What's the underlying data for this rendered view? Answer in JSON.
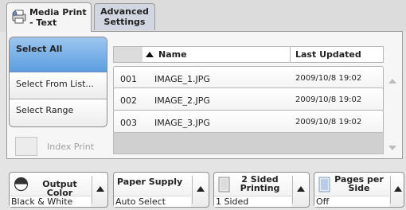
{
  "tabs": [
    {
      "label_line1": "Media Print",
      "label_line2": "- Text",
      "active": true
    },
    {
      "label_line1": "Advanced",
      "label_line2": "Settings",
      "active": false
    }
  ],
  "selection": {
    "select_all": "Select All",
    "select_from": "Select From List...",
    "select_range": "Select Range"
  },
  "index_print": {
    "label": "Index Print"
  },
  "table": {
    "columns": {
      "name": "Name",
      "updated": "Last Updated"
    },
    "rows": [
      {
        "num": "001",
        "name": "IMAGE_1.JPG",
        "date": "2009/10/8 19:02"
      },
      {
        "num": "002",
        "name": "IMAGE_2.JPG",
        "date": "2009/10/8 19:02"
      },
      {
        "num": "003",
        "name": "IMAGE_3.JPG",
        "date": "2009/10/8 19:02"
      }
    ]
  },
  "features": {
    "output_color": {
      "title": "Output Color",
      "value": "Black & White"
    },
    "paper_supply": {
      "title": "Paper Supply",
      "value": "Auto Select"
    },
    "sided": {
      "title_line1": "2 Sided",
      "title_line2": "Printing",
      "value": "1 Sided"
    },
    "pages_per_side": {
      "title_line1": "Pages per",
      "title_line2": "Side",
      "value": "Off"
    }
  },
  "colors": {
    "selected_blue": "#5d9ee0",
    "panel_bg": "#f6f6f6",
    "disabled_text": "#a0a0a0"
  }
}
